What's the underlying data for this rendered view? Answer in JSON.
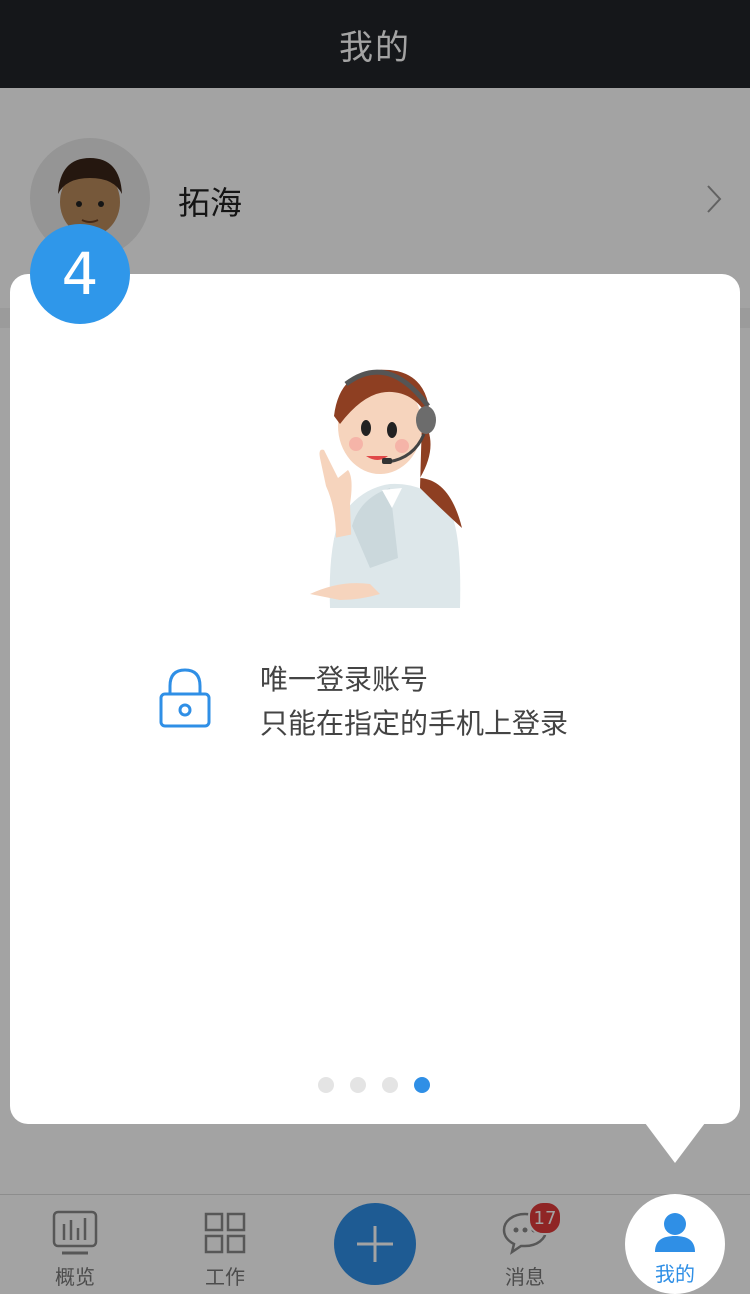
{
  "header": {
    "title": "我的"
  },
  "profile": {
    "name": "拓海"
  },
  "tabs": {
    "overview": "概览",
    "work": "工作",
    "messages": "消息",
    "messages_badge": "17",
    "me": "我的"
  },
  "guide": {
    "step": "4",
    "line1": "唯一登录账号",
    "line2": "只能在指定的手机上登录",
    "page_count": 4,
    "active_page": 4
  },
  "colors": {
    "accent": "#2f8fe6",
    "header_bg": "#222529",
    "badge": "#e03a3a"
  }
}
